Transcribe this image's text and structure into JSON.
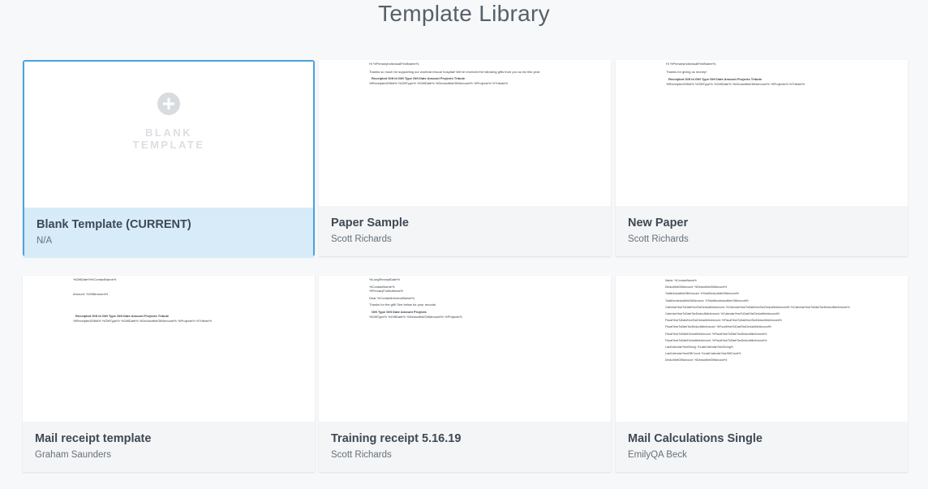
{
  "page": {
    "title": "Template Library"
  },
  "templates": [
    {
      "title": "Blank Template (CURRENT)",
      "author": "N/A",
      "current": true,
      "blank_label_line1": "BLANK",
      "blank_label_line2": "TEMPLATE"
    },
    {
      "title": "Paper Sample",
      "author": "Scott Richards",
      "preview_lines": [
        "Hi %PrimaryIndividualFirstName%,",
        "Thanks so much for supporting our wombat rescue hospital! We've received the following gifts from you so far this year:",
        "Receipted Gift Id    Gift Type    Gift Date            Amount              Projects    Tribute",
        "%ReceiptedGiftId% %GiftType% %GiftDate% %DeductibleGiftAmount% %Projects% %Tribute%"
      ]
    },
    {
      "title": "New Paper",
      "author": "Scott Richards",
      "preview_lines": [
        "Hi %PrimaryIndividualFirstName%,",
        "Thanks for giving us money!",
        "Receipted Gift Id    Gift Type    Gift Date            Amount              Projects    Tribute",
        "%ReceiptedGiftId% %GiftType% %GiftDate% %DeductibleGiftAmount% %Projects% %Tribute%"
      ]
    },
    {
      "title": "Mail receipt template",
      "author": "Graham Saunders",
      "preview_lines": [
        "%GiftDate%%ContactName%",
        "Amount: %GiftAmount%",
        "Receipted Gift Id    Gift Type    Gift Date            Amount              Projects    Tribute",
        "%ReceiptedGiftId% %GiftType% %GiftDate% %DeductibleGiftAmount% %Projects% %Tribute%"
      ]
    },
    {
      "title": "Training receipt 5.16.19",
      "author": "Scott Richards",
      "preview_lines": [
        "%LongReceiptDate%",
        "%ContactName%",
        "%PrimaryFullAddress%",
        "Dear %ContactInformalName%,",
        "Thanks for the gift! See below for your records.",
        "Gift Type    Gift Date            Amount              Projects",
        "%GiftType% %GiftDate% %DeductibleGiftAmount% %Projects%"
      ]
    },
    {
      "title": "Mail Calculations Single",
      "author": "EmilyQA Beck",
      "preview_lines": [
        "Name: %ContactName%",
        "DeductibleGiftAmount: %DeductibleGiftAmount%",
        "TotalDeductibleGiftAmount: %TotalDeductibleGiftAmount%",
        "TotalNondeductibleGiftAmount: %TotalNondeductibleGiftAmount%",
        "CalendarYearToDateNonTaxDeductibleAmount: %CalendarYearToDateNonTaxDeductibleAmount% %CalendarYearToDateTaxDeductibleAmount%",
        "CalendarYearToDateTaxDeductibleAmount: %CalendarYearToDateTaxDeductibleAmount%",
        "FiscalYearToDateNonTaxDeductibleAmount: %FiscalYearToDateNonTaxDeductibleAmount%",
        "FiscalYearToDateTaxDeductibleAmount: %FiscalYearToDateTaxDeductibleAmount%",
        "FiscalYearToDateDeductibleAmount: %FiscalYearToDateTaxDeductibleAmount%",
        "FiscalYearToDateDeductibleAmount: %FiscalYearToDateTaxDeductibleAmount%",
        "LastCalendarYearGiving: %LastCalendarYearGiving%",
        "LastCalendarYearGiftCount: %LastCalendarYearGiftCount%",
        "DeductibleGiftAmount: %DeductibleGiftAmount%"
      ]
    }
  ]
}
